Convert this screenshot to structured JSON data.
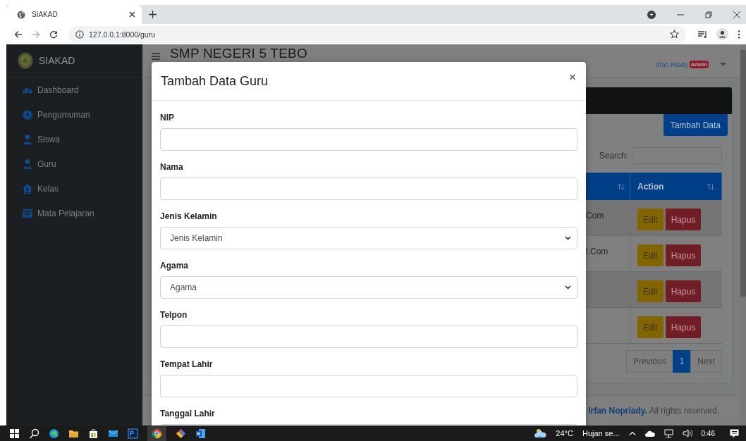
{
  "browser": {
    "tab": {
      "title": "SIAKAD",
      "selected": true
    },
    "url": "127.0.0.1:8000/guru"
  },
  "sidebar": {
    "brand": "SIAKAD",
    "items": [
      {
        "label": "Dashboard",
        "kind": "gauge"
      },
      {
        "label": "Pengumuman",
        "kind": "gear"
      },
      {
        "label": "Siswa",
        "kind": "person"
      },
      {
        "label": "Guru",
        "kind": "teacher"
      },
      {
        "label": "Kelas",
        "kind": "house"
      },
      {
        "label": "Mata Pelajaran",
        "kind": "grid"
      }
    ]
  },
  "header": {
    "title": "SMP NEGERI 5 TEBO",
    "user": "Irfan Riady",
    "badge": "Admin"
  },
  "card": {
    "add_button": "Tambah Data",
    "search_label": "Search:",
    "table": {
      "action_header": "Action",
      "rows": [
        {
          "column_1": "Com",
          "edit": "Edit",
          "delete": "Hapus"
        },
        {
          "column_1": "l.Com",
          "edit": "Edit",
          "delete": "Hapus"
        },
        {
          "edit": "Edit",
          "delete": "Hapus"
        },
        {
          "edit": "Edit",
          "delete": "Hapus"
        }
      ]
    },
    "pagination": [
      {
        "label": "Previous",
        "selected": false
      },
      {
        "label": "1",
        "selected": true
      },
      {
        "label": "Next",
        "selected": false
      }
    ]
  },
  "footer": {
    "author": "Irfan Nopriady.",
    "text": "All rights reserved."
  },
  "modal": {
    "title": "Tambah Data Guru",
    "close": "×",
    "fields": [
      {
        "label": "NIP",
        "kind": "text"
      },
      {
        "label": "Nama",
        "kind": "text"
      },
      {
        "label": "Jenis Kelamin",
        "kind": "select",
        "value": "Jenis Kelamin"
      },
      {
        "label": "Agama",
        "kind": "select",
        "value": "Agama"
      },
      {
        "label": "Telpon",
        "kind": "text"
      },
      {
        "label": "Tempat Lahir",
        "kind": "text"
      },
      {
        "label": "Tanggal Lahir",
        "kind": "text"
      }
    ]
  },
  "taskbar": {
    "temperature": "24°C",
    "weather": "Hujan se...",
    "time": "0:46"
  }
}
